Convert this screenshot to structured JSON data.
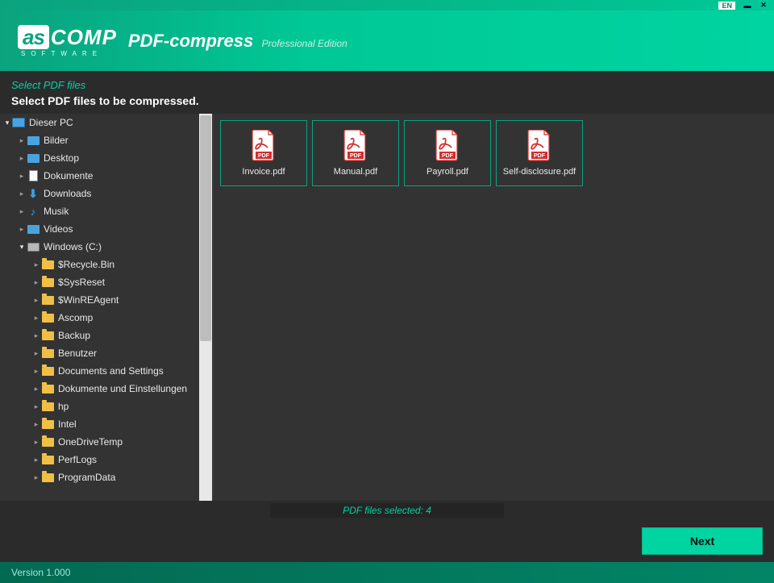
{
  "titlebar": {
    "lang": "EN"
  },
  "header": {
    "logo_as": "as",
    "logo_comp": "COMP",
    "logo_sub": "SOFTWARE",
    "app_title": "PDF-compress",
    "app_edition": "Professional Edition"
  },
  "step": {
    "title": "Select PDF files",
    "desc": "Select PDF files to be compressed."
  },
  "tree": {
    "root": "Dieser PC",
    "userFolders": [
      {
        "label": "Bilder",
        "icon": "img"
      },
      {
        "label": "Desktop",
        "icon": "img"
      },
      {
        "label": "Dokumente",
        "icon": "doc"
      },
      {
        "label": "Downloads",
        "icon": "dl"
      },
      {
        "label": "Musik",
        "icon": "music"
      },
      {
        "label": "Videos",
        "icon": "vid"
      }
    ],
    "drive": "Windows  (C:)",
    "driveFolders": [
      "$Recycle.Bin",
      "$SysReset",
      "$WinREAgent",
      "Ascomp",
      "Backup",
      "Benutzer",
      "Documents and Settings",
      "Dokumente und Einstellungen",
      "hp",
      "Intel",
      "OneDriveTemp",
      "PerfLogs",
      "ProgramData"
    ]
  },
  "files": [
    "Invoice.pdf",
    "Manual.pdf",
    "Payroll.pdf",
    "Self-disclosure.pdf"
  ],
  "status": "PDF files selected: 4",
  "next": "Next",
  "footer": "Version 1.000"
}
